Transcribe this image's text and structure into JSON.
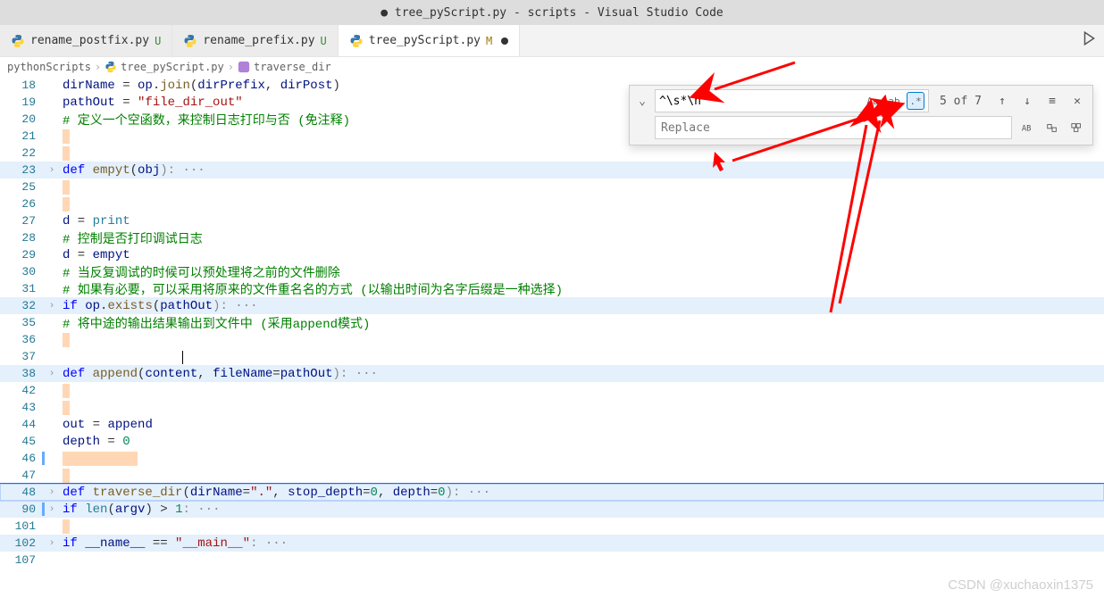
{
  "title": "● tree_pyScript.py - scripts - Visual Studio Code",
  "tabs": [
    {
      "label": "rename_postfix.py",
      "vcs": "U"
    },
    {
      "label": "rename_prefix.py",
      "vcs": "U"
    },
    {
      "label": "tree_pyScript.py",
      "vcs": "M",
      "dirty": true
    }
  ],
  "breadcrumbs": {
    "root": "pythonScripts",
    "file": "tree_pyScript.py",
    "symbol": "traverse_dir"
  },
  "find": {
    "search_value": "^\\s*\\n",
    "replace_placeholder": "Replace",
    "count": "5 of 7",
    "opts": {
      "case": "Aa",
      "word": "ab",
      "regex": ".*"
    }
  },
  "code": {
    "l18_a": "dirName",
    "l18_b": " = ",
    "l18_c": "op",
    "l18_d": ".",
    "l18_e": "join",
    "l18_f": "(",
    "l18_g": "dirPrefix",
    "l18_h": ", ",
    "l18_i": "dirPost",
    "l18_j": ")",
    "l19_a": "pathOut",
    "l19_b": " = ",
    "l19_c": "\"file_dir_out\"",
    "l20": "# 定义一个空函数，来控制日志打印与否 (免注释)",
    "l23_a": "def",
    "l23_b": " ",
    "l23_c": "empyt",
    "l23_d": "(",
    "l23_e": "obj",
    "l23_f": "): ···",
    "l27_a": "d",
    "l27_b": " = ",
    "l27_c": "print",
    "l28": "# 控制是否打印调试日志",
    "l29_a": "d",
    "l29_b": " = ",
    "l29_c": "empyt",
    "l30": "# 当反复调试的时候可以预处理将之前的文件删除",
    "l31": "# 如果有必要，可以采用将原来的文件重名名的方式 (以输出时间为名字后缀是一种选择)",
    "l32_a": "if",
    "l32_b": " ",
    "l32_c": "op",
    "l32_d": ".",
    "l32_e": "exists",
    "l32_f": "(",
    "l32_g": "pathOut",
    "l32_h": "): ···",
    "l35": "# 将中途的输出结果输出到文件中 (采用append模式)",
    "l38_a": "def",
    "l38_b": " ",
    "l38_c": "append",
    "l38_d": "(",
    "l38_e": "content",
    "l38_f": ", ",
    "l38_g": "fileName",
    "l38_h": "=",
    "l38_i": "pathOut",
    "l38_j": "): ···",
    "l44_a": "out",
    "l44_b": " = ",
    "l44_c": "append",
    "l45_a": "depth",
    "l45_b": " = ",
    "l45_c": "0",
    "l48_a": "def",
    "l48_b": " ",
    "l48_c": "traverse_dir",
    "l48_d": "(",
    "l48_e": "dirName",
    "l48_f": "=",
    "l48_g": "\".\"",
    "l48_h": ", ",
    "l48_i": "stop_depth",
    "l48_j": "=",
    "l48_k": "0",
    "l48_l": ", ",
    "l48_m": "depth",
    "l48_n": "=",
    "l48_o": "0",
    "l48_p": "): ···",
    "l90_a": "if",
    "l90_b": " ",
    "l90_c": "len",
    "l90_d": "(",
    "l90_e": "argv",
    "l90_f": ") > ",
    "l90_g": "1",
    "l90_h": ": ···",
    "l102_a": "if",
    "l102_b": " ",
    "l102_c": "__name__",
    "l102_d": " == ",
    "l102_e": "\"__main__\"",
    "l102_f": ": ···"
  },
  "gutters": [
    "18",
    "19",
    "20",
    "21",
    "22",
    "23",
    "25",
    "26",
    "27",
    "28",
    "29",
    "30",
    "31",
    "32",
    "35",
    "36",
    "37",
    "38",
    "42",
    "43",
    "44",
    "45",
    "46",
    "47",
    "48",
    "90",
    "101",
    "102",
    "107"
  ],
  "watermark": "CSDN @xuchaoxin1375"
}
